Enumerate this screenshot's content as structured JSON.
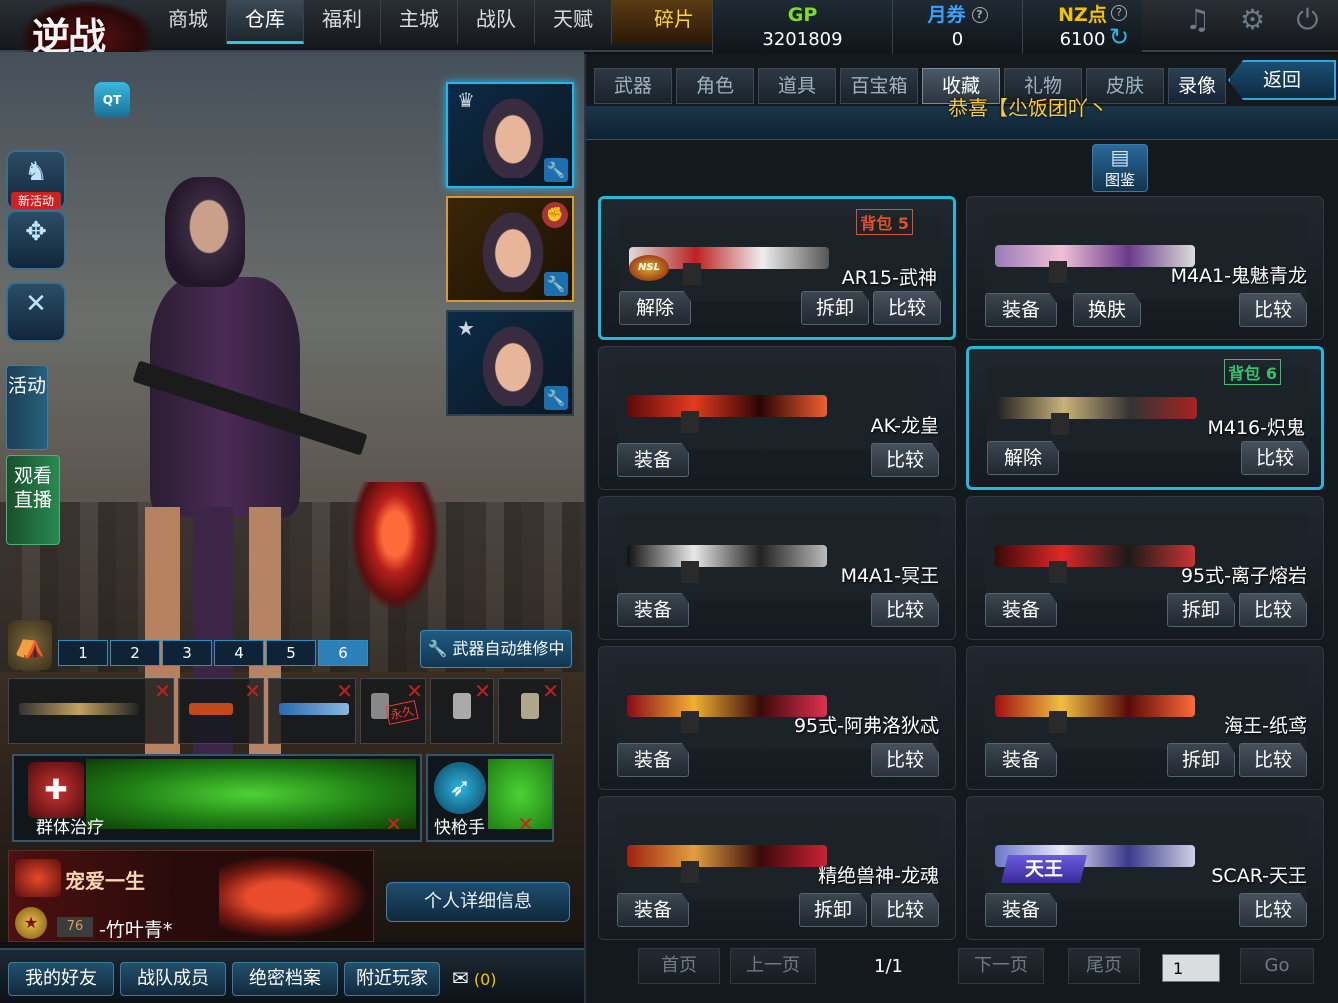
{
  "logo": "逆战",
  "nav": [
    "商城",
    "仓库",
    "福利",
    "主城",
    "战队",
    "天赋",
    "碎片"
  ],
  "nav_active": 1,
  "currency": {
    "gp_label": "GP",
    "gp_value": "3201809",
    "mq_label": "月券",
    "mq_value": "0",
    "nz_label": "NZ点",
    "nz_value": "6100"
  },
  "left": {
    "chat_icon": "QT",
    "new_activity": "新活动",
    "tab_activity": "活动",
    "tab_live": "观看直播",
    "slots": [
      "1",
      "2",
      "3",
      "4",
      "5",
      "6"
    ],
    "active_slot": 5,
    "repair_label": "武器自动维修中",
    "permanent_tag": "永久",
    "skill_main": "群体治疗",
    "skill_second": "快枪手",
    "pet_name": "宠爱一生",
    "level": "76",
    "username": "-竹叶青*",
    "detail_btn": "个人详细信息",
    "bottom": [
      "我的好友",
      "战队成员",
      "绝密档案",
      "附近玩家"
    ],
    "mail_count": "(0)"
  },
  "panel": {
    "tabs": [
      "武器",
      "角色",
      "道具",
      "百宝箱",
      "收藏",
      "礼物",
      "皮肤"
    ],
    "tab_active": 4,
    "record": "录像",
    "back": "返回",
    "notice": "恭喜【尐饭团吖丶",
    "gallery": "图鉴",
    "cards": [
      {
        "name": "AR15-武神",
        "bag": "背包 5",
        "hl": true,
        "btns": [
          "解除",
          "拆卸",
          "比较"
        ]
      },
      {
        "name": "M4A1-鬼魅青龙",
        "bag": "",
        "hl": false,
        "btns": [
          "装备",
          "换肤",
          "比较"
        ]
      },
      {
        "name": "AK-龙皇",
        "bag": "",
        "hl": false,
        "btns": [
          "装备",
          "",
          "比较"
        ]
      },
      {
        "name": "M416-炽鬼",
        "bag": "背包 6",
        "hl": true,
        "btns": [
          "解除",
          "",
          "比较"
        ]
      },
      {
        "name": "M4A1-冥王",
        "bag": "",
        "hl": false,
        "btns": [
          "装备",
          "",
          "比较"
        ]
      },
      {
        "name": "95式-离子熔岩",
        "bag": "",
        "hl": false,
        "btns": [
          "装备",
          "拆卸",
          "比较"
        ]
      },
      {
        "name": "95式-阿弗洛狄忒",
        "bag": "",
        "hl": false,
        "btns": [
          "装备",
          "",
          "比较"
        ]
      },
      {
        "name": "海王-纸鸢",
        "bag": "",
        "hl": false,
        "btns": [
          "装备",
          "拆卸",
          "比较"
        ]
      },
      {
        "name": "精绝兽神-龙魂",
        "bag": "",
        "hl": false,
        "btns": [
          "装备",
          "拆卸",
          "比较"
        ]
      },
      {
        "name": "SCAR-天王",
        "bag": "",
        "hl": false,
        "btns": [
          "装备",
          "",
          "比较"
        ]
      }
    ],
    "nsl_badge": "NSL",
    "tianwang_badge": "天王",
    "pager": {
      "first": "首页",
      "prev": "上一页",
      "page": "1/1",
      "next": "下一页",
      "last": "尾页",
      "input": "1",
      "go": "Go"
    }
  },
  "colors": {
    "accent": "#22b8d6",
    "bag_red": "#e0502a",
    "bag_green": "#38c070",
    "gold": "#ffcc33"
  }
}
